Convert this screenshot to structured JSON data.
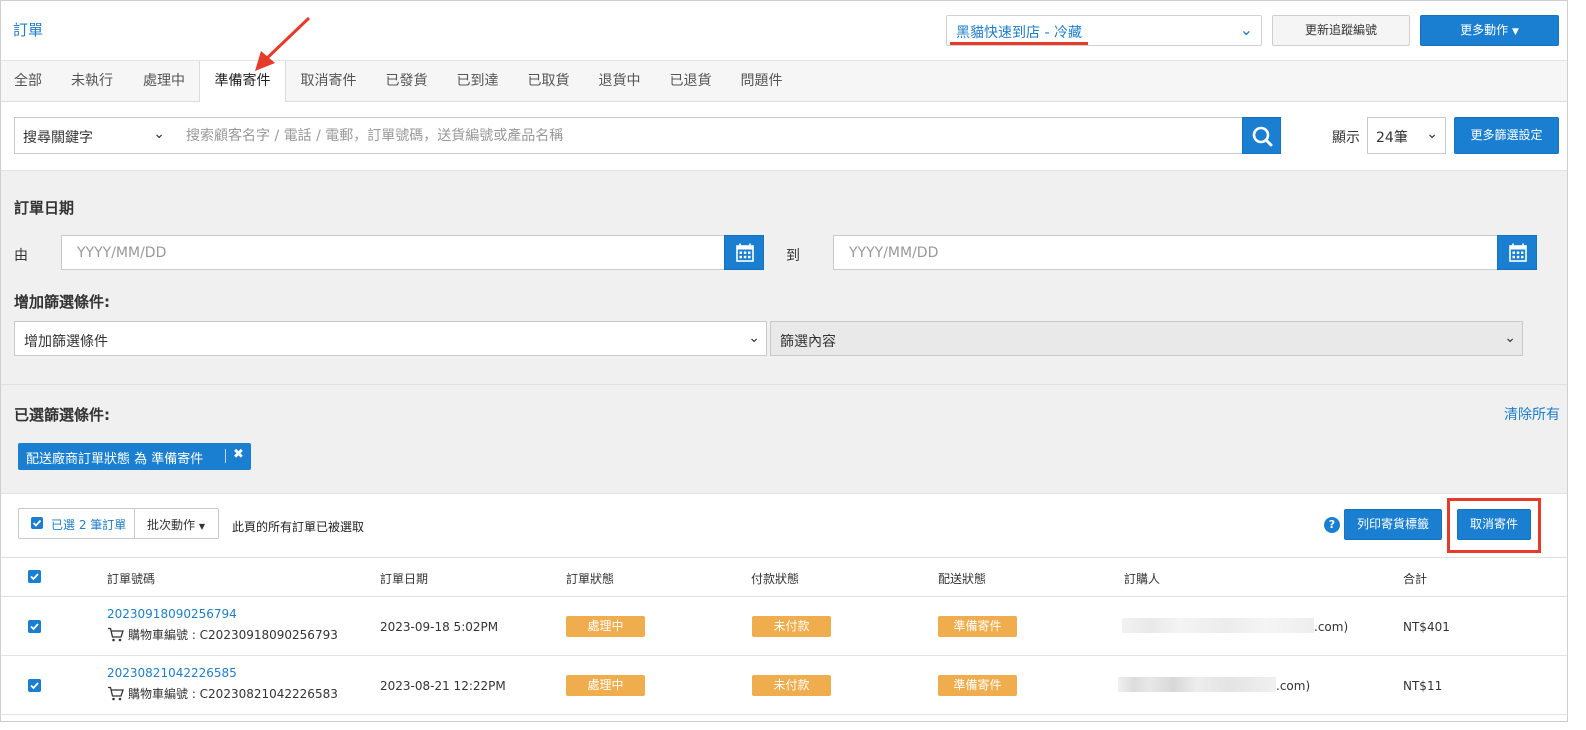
{
  "header": {
    "title": "訂單",
    "carrier_select": "黑貓快速到店 - 冷藏",
    "update_tracking_label": "更新追蹤編號",
    "more_actions_label": "更多動作"
  },
  "tabs": [
    "全部",
    "未執行",
    "處理中",
    "準備寄件",
    "取消寄件",
    "已發貨",
    "已到達",
    "已取貨",
    "退貨中",
    "已退貨",
    "問題件"
  ],
  "active_tab": "準備寄件",
  "search": {
    "keyword_select": "搜尋關鍵字",
    "placeholder": "搜索顧客名字 / 電話 / 電郵，訂單號碼，送貨編號或產品名稱",
    "display_label": "顯示",
    "display_value": "24筆",
    "more_filters_label": "更多篩選設定"
  },
  "filters": {
    "order_date_title": "訂單日期",
    "from_label": "由",
    "to_label": "到",
    "date_placeholder": "YYYY/MM/DD",
    "add_filter_title": "增加篩選條件:",
    "add_filter_select": "增加篩選條件",
    "filter_content_select": "篩選內容",
    "selected_title": "已選篩選條件:",
    "clear_all_label": "清除所有",
    "active_chip": "配送廠商訂單狀態 為 準備寄件"
  },
  "batch": {
    "selected_count": "已選 2 筆訂單",
    "batch_actions_label": "批次動作",
    "all_selected_note": "此頁的所有訂單已被選取",
    "print_label": "列印寄貨標籤",
    "cancel_shipment_label": "取消寄件"
  },
  "table": {
    "columns": [
      "訂單號碼",
      "訂單日期",
      "訂單狀態",
      "付款狀態",
      "配送狀態",
      "訂購人",
      "合計"
    ],
    "rows": [
      {
        "order_no": "20230918090256794",
        "cart_line": "購物車編號 : C20230918090256793",
        "date": "2023-09-18 5:02PM",
        "order_status": "處理中",
        "payment_status": "未付款",
        "delivery_status": "準備寄件",
        "customer_suffix": ".com)",
        "total": "NT$401"
      },
      {
        "order_no": "20230821042226585",
        "cart_line": "購物車編號 : C20230821042226583",
        "date": "2023-08-21 12:22PM",
        "order_status": "處理中",
        "payment_status": "未付款",
        "delivery_status": "準備寄件",
        "customer_suffix": ".com)",
        "total": "NT$11"
      }
    ]
  },
  "colors": {
    "accent": "#1a7fd0",
    "badge_orange": "#f0ad4e",
    "annotation_red": "#e53b2b"
  }
}
